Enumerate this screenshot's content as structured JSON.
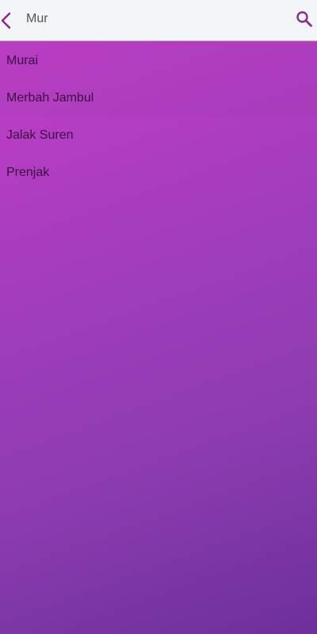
{
  "search": {
    "value": "Mur"
  },
  "icons": {
    "back": "chevron-left-icon",
    "search": "magnifier-icon"
  },
  "colors": {
    "accent": "#8e2a96",
    "header_bg": "#f3f6f6",
    "gradient_start": "#c63dc9",
    "gradient_end": "#6c309b",
    "item_text": "#3a1040"
  },
  "results": [
    {
      "label": "Murai"
    },
    {
      "label": "Merbah Jambul"
    },
    {
      "label": "Jalak Suren"
    },
    {
      "label": "Prenjak"
    }
  ]
}
